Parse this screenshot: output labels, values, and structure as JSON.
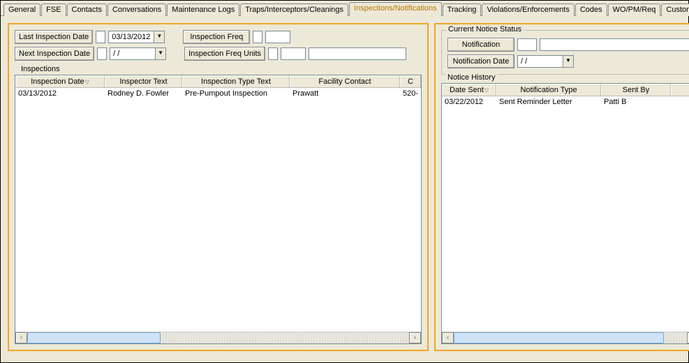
{
  "tabs": {
    "items": [
      {
        "label": "General"
      },
      {
        "label": "FSE"
      },
      {
        "label": "Contacts"
      },
      {
        "label": "Conversations"
      },
      {
        "label": "Maintenance Logs"
      },
      {
        "label": "Traps/Interceptors/Cleanings"
      },
      {
        "label": "Inspections/Notifications"
      },
      {
        "label": "Tracking"
      },
      {
        "label": "Violations/Enforcements"
      },
      {
        "label": "Codes"
      },
      {
        "label": "WO/PM/Req"
      },
      {
        "label": "Custom"
      }
    ],
    "active_index": 6,
    "scroll_left": "◄",
    "scroll_right": "►"
  },
  "left": {
    "last_inspection_date_label": "Last Inspection Date",
    "last_inspection_date_value": "03/13/2012",
    "next_inspection_date_label": "Next Inspection Date",
    "next_inspection_date_value": "  /  /",
    "inspection_freq_label": "Inspection Freq",
    "inspection_freq_value": "",
    "inspection_freq_units_label": "Inspection Freq Units",
    "inspection_freq_units_code": "",
    "inspection_freq_units_text": "",
    "group_title": "Inspections",
    "columns": [
      {
        "label": "Inspection Date",
        "sort": "▽"
      },
      {
        "label": "Inspector Text"
      },
      {
        "label": "Inspection Type Text"
      },
      {
        "label": "Facility Contact"
      },
      {
        "label": "C"
      }
    ],
    "rows": [
      {
        "date": "03/13/2012",
        "inspector": "Rodney D. Fowler",
        "type": "Pre-Pumpout Inspection",
        "contact": "Prawatt",
        "c": "520-"
      }
    ]
  },
  "right": {
    "status_group_title": "Current Notice Status",
    "notification_label": "Notification",
    "notification_code": "",
    "notification_text": "",
    "notification_date_label": "Notification Date",
    "notification_date_value": "  /  /",
    "history_group_title": "Notice History",
    "columns": [
      {
        "label": "Date Sent",
        "sort": "▽"
      },
      {
        "label": "Notification Type"
      },
      {
        "label": "Sent By"
      },
      {
        "label": ""
      }
    ],
    "rows": [
      {
        "date": "03/22/2012",
        "type": "Sent Reminder Letter",
        "by": "Patti B"
      }
    ]
  },
  "glyphs": {
    "dropdown": "▼",
    "scroll_left": "‹",
    "scroll_right": "›"
  }
}
